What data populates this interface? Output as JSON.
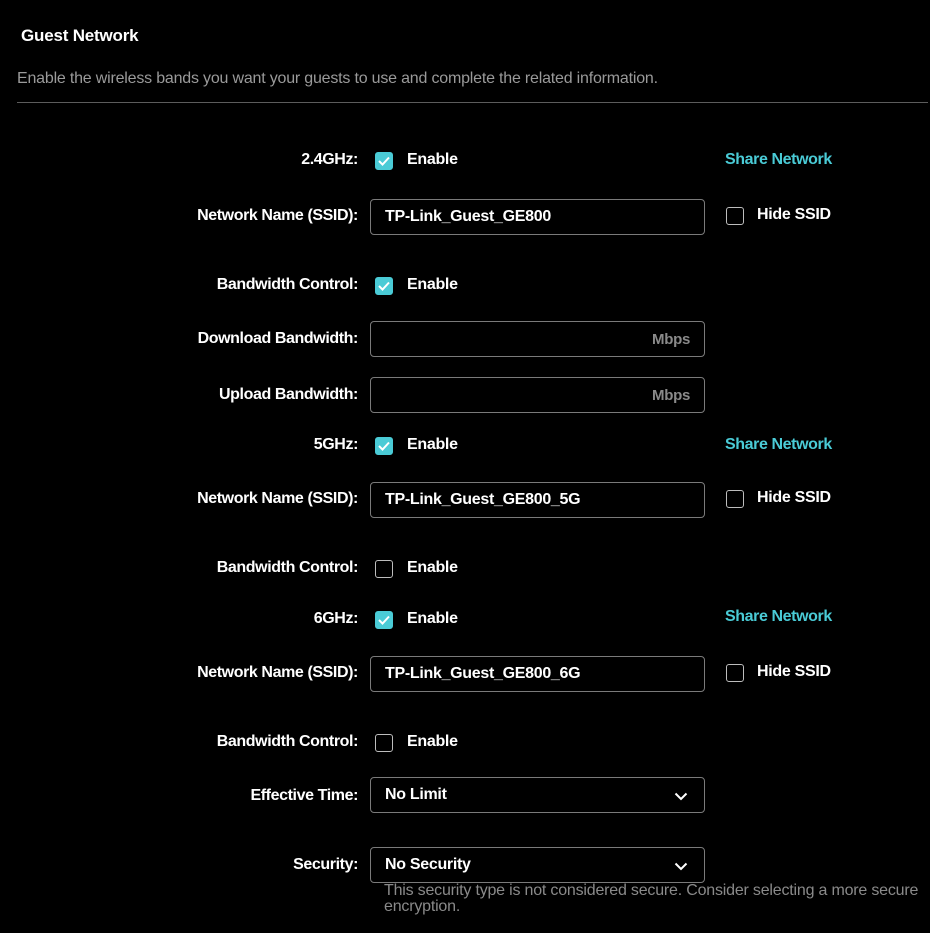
{
  "header": {
    "title": "Guest Network",
    "description": "Enable the wireless bands you want your guests to use and complete the related information."
  },
  "band_24": {
    "label": "2.4GHz:",
    "enable_label": "Enable",
    "enabled": true,
    "share_label": "Share Network",
    "ssid_label": "Network Name (SSID):",
    "ssid_value": "TP-Link_Guest_GE800",
    "hide_ssid_label": "Hide SSID",
    "hide_ssid": false,
    "bw_label": "Bandwidth Control:",
    "bw_enable_label": "Enable",
    "bw_enabled": true,
    "download_label": "Download Bandwidth:",
    "download_unit": "Mbps",
    "download_value": "",
    "upload_label": "Upload Bandwidth:",
    "upload_unit": "Mbps",
    "upload_value": ""
  },
  "band_5": {
    "label": "5GHz:",
    "enable_label": "Enable",
    "enabled": true,
    "share_label": "Share Network",
    "ssid_label": "Network Name (SSID):",
    "ssid_value": "TP-Link_Guest_GE800_5G",
    "hide_ssid_label": "Hide SSID",
    "hide_ssid": false,
    "bw_label": "Bandwidth Control:",
    "bw_enable_label": "Enable",
    "bw_enabled": false
  },
  "band_6": {
    "label": "6GHz:",
    "enable_label": "Enable",
    "enabled": true,
    "share_label": "Share Network",
    "ssid_label": "Network Name (SSID):",
    "ssid_value": "TP-Link_Guest_GE800_6G",
    "hide_ssid_label": "Hide SSID",
    "hide_ssid": false,
    "bw_label": "Bandwidth Control:",
    "bw_enable_label": "Enable",
    "bw_enabled": false
  },
  "effective_time": {
    "label": "Effective Time:",
    "value": "No Limit"
  },
  "security": {
    "label": "Security:",
    "value": "No Security",
    "warning": "This security type is not considered secure. Consider selecting a more secure encryption."
  },
  "colors": {
    "accent": "#4acbd6",
    "background": "#000000",
    "muted_text": "#9a9a9a"
  },
  "icons": {
    "checked": "checkmark-icon",
    "dropdown": "chevron-down-icon"
  }
}
